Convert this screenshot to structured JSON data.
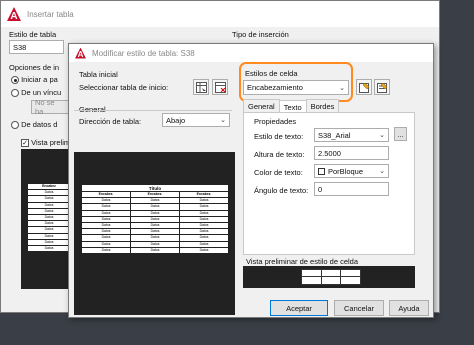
{
  "back": {
    "title": "Insertar tabla",
    "table_style_label": "Estilo de tabla",
    "table_style_value": "S38",
    "insert_options_label": "Opciones de in",
    "radio_start": "Iniciar a pa",
    "radio_link": "De un víncu",
    "no_link": "No se ha",
    "radio_data": "De datos d",
    "preview_label": "Vista prelimi",
    "insert_type_label": "Tipo de inserción"
  },
  "front": {
    "title": "Modificar estilo de tabla: S38",
    "initial_table_label": "Tabla inicial",
    "select_start_table": "Seleccionar tabla de inicio:",
    "general_label": "General",
    "direction_label": "Dirección de tabla:",
    "direction_value": "Abajo",
    "cell_styles_label": "Estilos de celda",
    "cell_style_value": "Encabezamiento",
    "tabs": [
      "General",
      "Texto",
      "Bordes"
    ],
    "properties_label": "Propiedades",
    "text_style_label": "Estilo de texto:",
    "text_style_value": "S38_Arial",
    "text_height_label": "Altura de texto:",
    "text_height_value": "2.5000",
    "text_color_label": "Color de texto:",
    "text_color_value": "PorBloque",
    "text_angle_label": "Ángulo de texto:",
    "text_angle_value": "0",
    "cell_preview_label": "Vista preliminar de estilo de celda",
    "accept": "Aceptar",
    "cancel": "Cancelar",
    "help": "Ayuda",
    "ellipsis": "..."
  },
  "preview_table": {
    "title": "Título",
    "header": [
      "Encabez.",
      "Encabez.",
      "Encabez."
    ],
    "cell": "Datos",
    "rows": 9
  },
  "back_preview_table": {
    "header": "Encabez",
    "cell": "Datos",
    "rows": 10
  },
  "colors": {
    "highlight": "#ff8a1f",
    "brand": "#c8102e",
    "default_button_border": "#0078d7"
  }
}
